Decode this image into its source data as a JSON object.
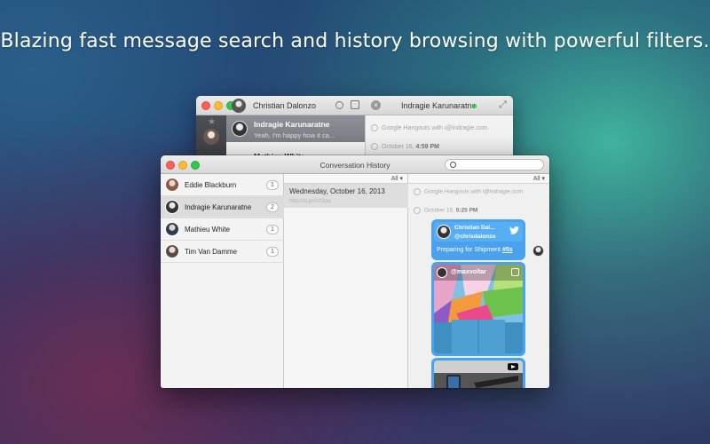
{
  "headline": "Blazing fast message search and history browsing with powerful filters.",
  "back_window": {
    "user_name": "Christian Dalonzo",
    "conversation_name": "Indragie Karunaratne",
    "list": [
      {
        "name": "Indragie Karunaratne",
        "preview": "Yeah, I'm happy how it ca..."
      },
      {
        "name": "Mathieu White",
        "preview": ""
      }
    ],
    "chat": {
      "system_line": "Google Hangouts with i@indragie.com",
      "date_line": "October 16,",
      "time": "4:59 PM"
    }
  },
  "front_window": {
    "title": "Conversation History",
    "search": {
      "value": "",
      "placeholder": ""
    },
    "contacts": [
      {
        "name": "Eddie Blackburn",
        "count": "1",
        "avatar_color": "#8a5a46"
      },
      {
        "name": "Indragie Karunaratne",
        "count": "2",
        "avatar_color": "#333333"
      },
      {
        "name": "Mathieu White",
        "count": "1",
        "avatar_color": "#2f3a4a"
      },
      {
        "name": "Tim Van Damme",
        "count": "1",
        "avatar_color": "#5b4a44"
      }
    ],
    "dates_filter": "All ▾",
    "dates": [
      {
        "title": "Wednesday, October 16, 2013",
        "link": "http://d.pr/i/z3pq"
      }
    ],
    "chat_filter": "All ▾",
    "chat": {
      "system_line": "Google Hangouts with i@indragie.com",
      "date_line": "October 16,",
      "time": "5:25 PM",
      "tweet": {
        "name": "Christian Dal...",
        "handle": "@chrisdalonzo",
        "text": "Preparing for Shipment",
        "hashtag": "#5s"
      },
      "instagram_handle": "@maxvoltar"
    }
  },
  "colors": {
    "bubble_blue": "#4aa2ee",
    "online_green": "#3ec14a",
    "selected_row": "#dcdcdc"
  }
}
